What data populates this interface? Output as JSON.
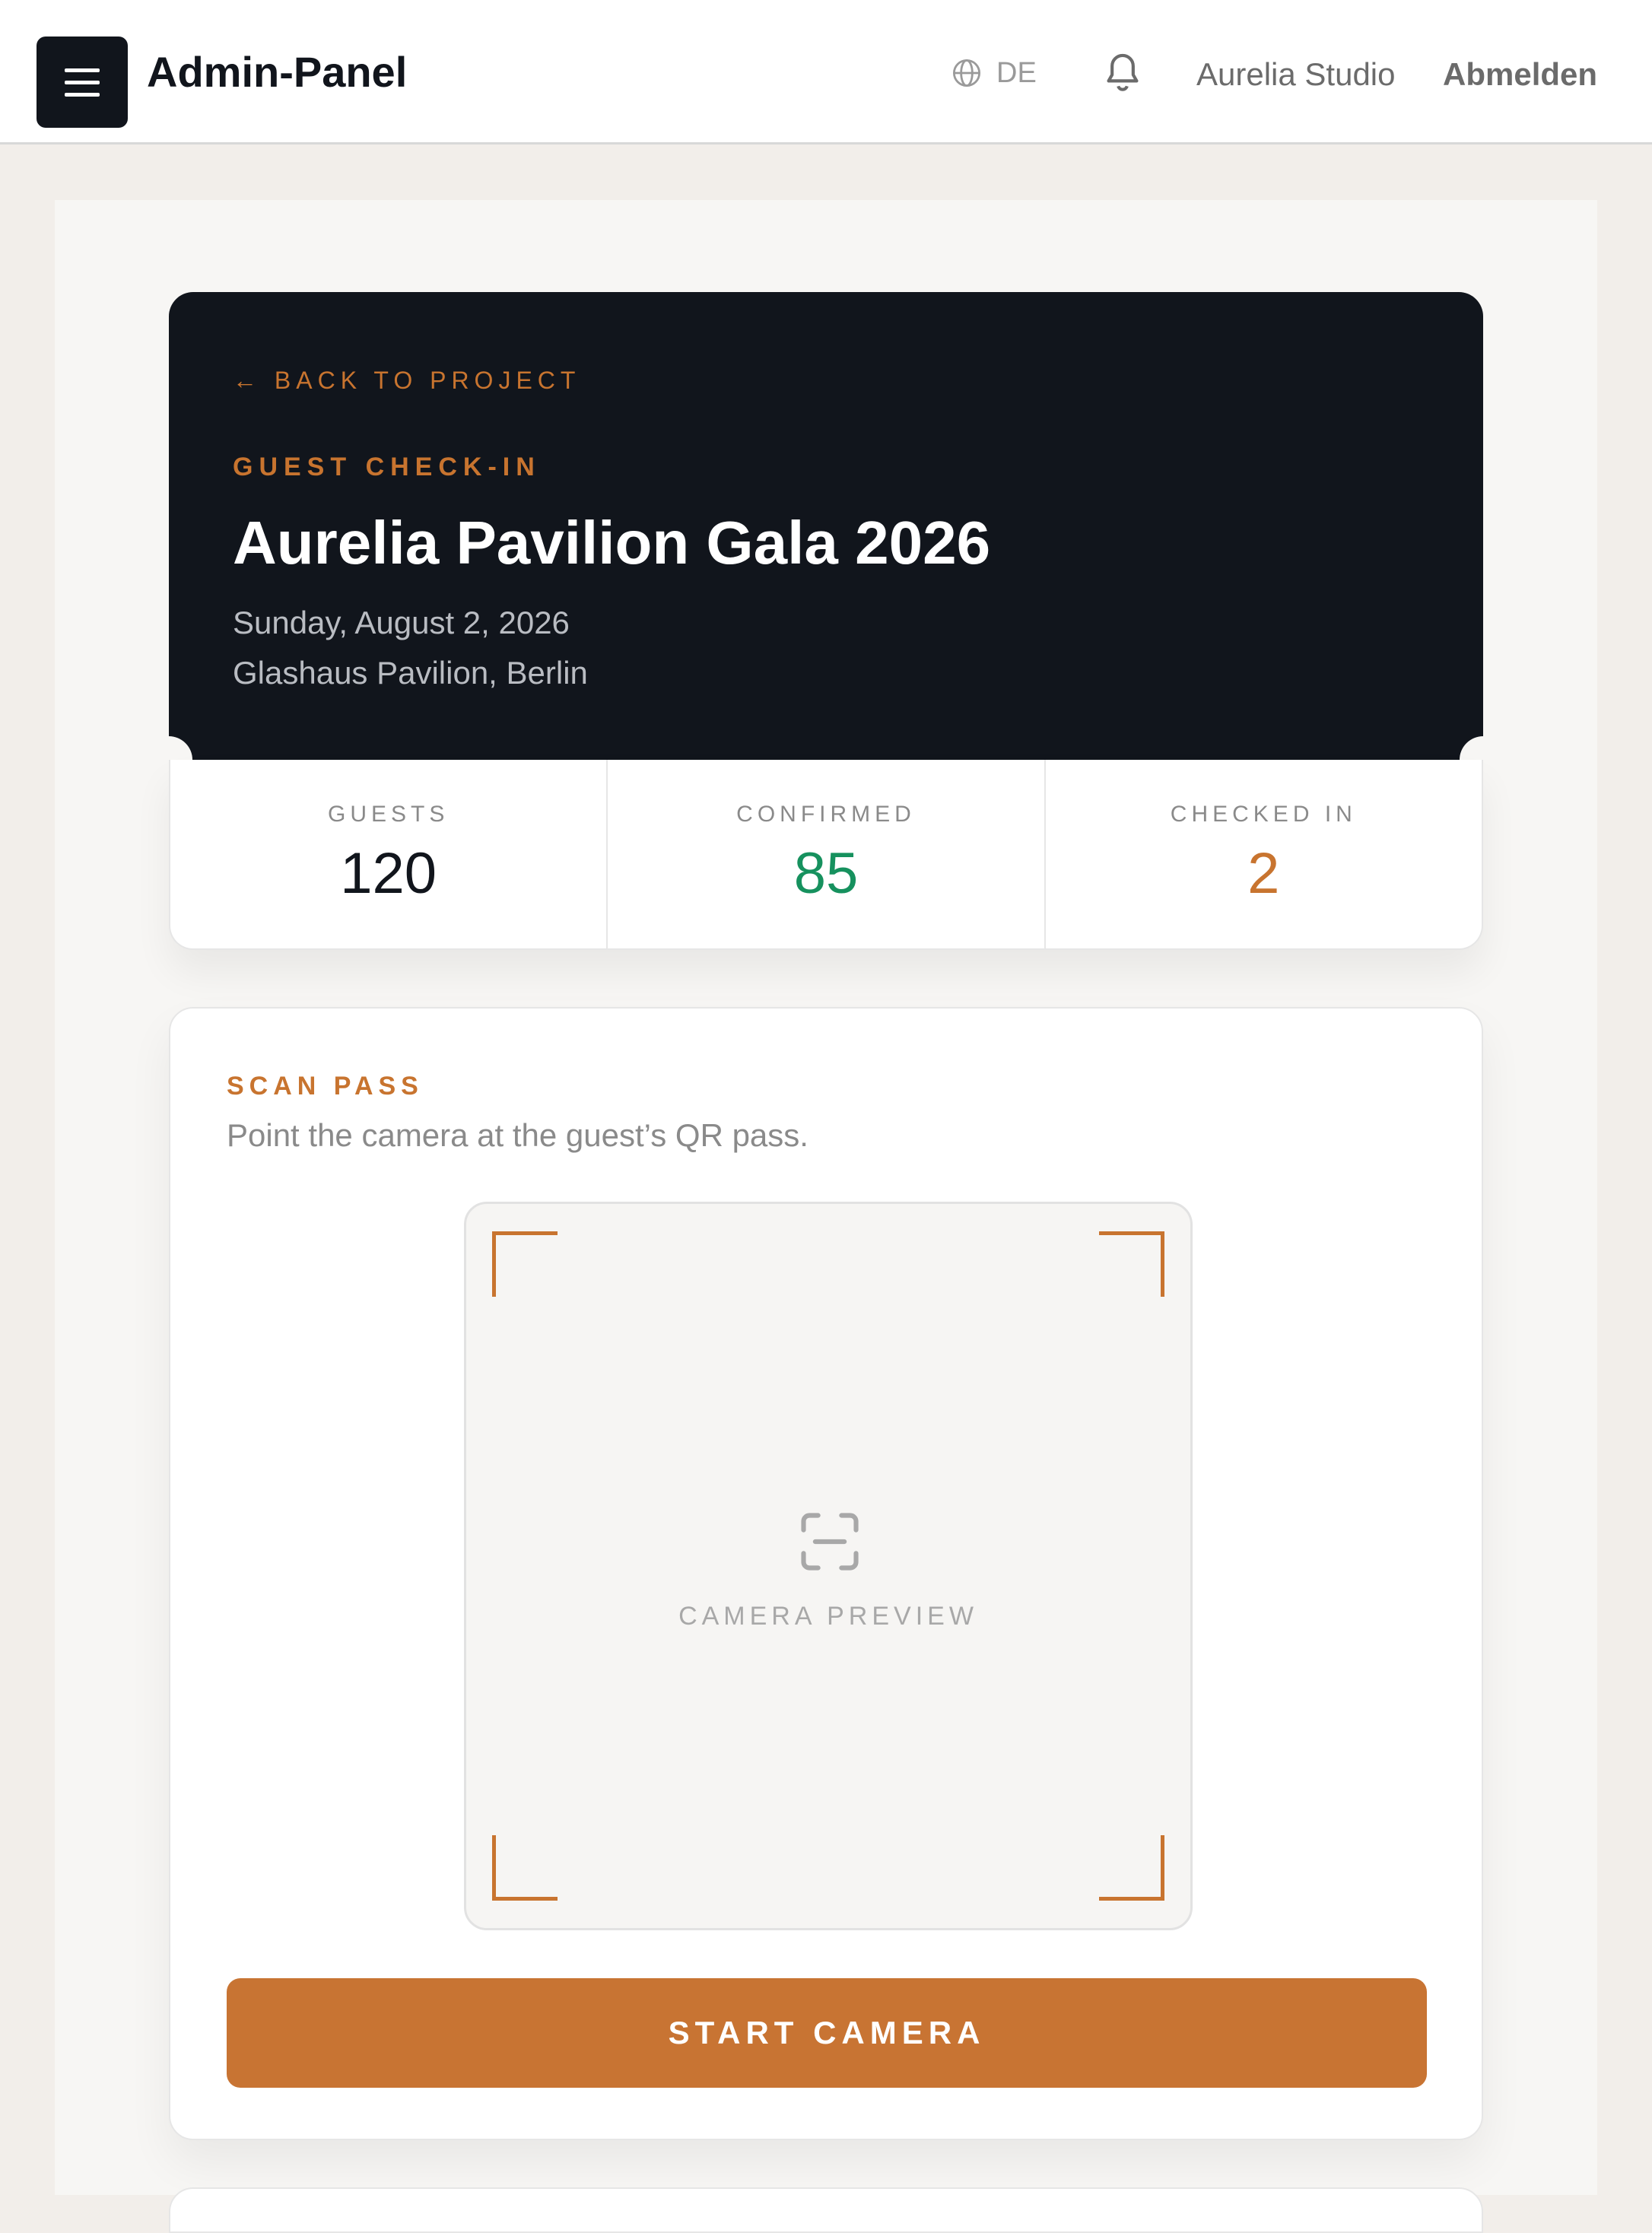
{
  "header": {
    "title": "Admin-Panel",
    "language": "DE",
    "user_name": "Aurelia Studio",
    "logout_label": "Abmelden",
    "icons": {
      "menu": "hamburger-menu-icon",
      "language": "globe-icon",
      "notifications": "bell-icon"
    }
  },
  "hero": {
    "back_link": "← BACK TO PROJECT",
    "eyebrow": "GUEST CHECK-IN",
    "title": "Aurelia Pavilion Gala 2026",
    "date": "Sunday, August 2, 2026",
    "venue": "Glashaus Pavilion, Berlin"
  },
  "stats": [
    {
      "label": "GUESTS",
      "value": "120",
      "color": "#11151c"
    },
    {
      "label": "CONFIRMED",
      "value": "85",
      "color": "#16915e"
    },
    {
      "label": "CHECKED IN",
      "value": "2",
      "color": "#c8742f"
    }
  ],
  "scan": {
    "eyebrow": "SCAN PASS",
    "hint": "Point the camera at the guest’s QR pass.",
    "preview_label": "CAMERA PREVIEW",
    "preview_icon": "scan-frame-icon",
    "button_label": "START CAMERA"
  },
  "colors": {
    "accent": "#c8742f",
    "dark": "#11151c",
    "confirmed": "#16915e",
    "background": "#f2eeea"
  }
}
